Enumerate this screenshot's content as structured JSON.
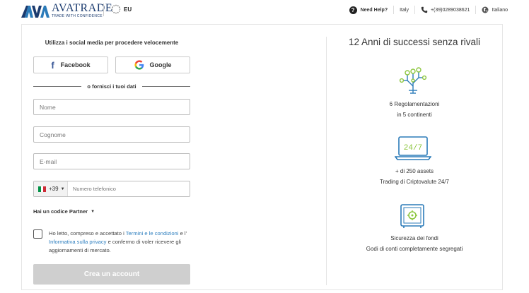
{
  "header": {
    "logo_name": "AVATRADE",
    "logo_tagline": "TRADE WITH CONFIDENCE",
    "region": "EU",
    "help": "Need Help?",
    "country": "Italy",
    "phone": "+(39)0289038621",
    "language": "Italiano"
  },
  "form": {
    "social_title": "Utilizza i social media per procedere velocemente",
    "facebook_label": "Facebook",
    "google_label": "Google",
    "or_text": "o fornisci i tuoi dati",
    "fields": {
      "first_name_placeholder": "Nome",
      "last_name_placeholder": "Cognome",
      "email_placeholder": "E-mail",
      "phone_prefix": "+39",
      "phone_placeholder": "Numero telefonico"
    },
    "partner_label": "Hai un codice Partner",
    "consent": {
      "part1": "Ho letto, compreso e accettato i ",
      "terms_link": "Termini e le condizioni",
      "part2": " e l' ",
      "privacy_link": "Informativa sulla privacy",
      "part3": " e confermo di voler ricevere gli aggiornamenti di mercato."
    },
    "submit_label": "Crea un account"
  },
  "benefits": {
    "title": "12 Anni di successi senza rivali",
    "items": [
      {
        "icon": "regulation-icon",
        "line1": "6 Regolamentazioni",
        "line2": "in 5 continenti"
      },
      {
        "icon": "laptop-24-7-icon",
        "line1": "+ di 250 assets",
        "line2": "Trading di Criptovalute 24/7"
      },
      {
        "icon": "safe-icon",
        "line1": "Sicurezza dei fondi",
        "line2": "Godi di conti completamente segregati"
      }
    ],
    "laptop_screen_text": "24/7"
  },
  "colors": {
    "brand_navy": "#1b3b6f",
    "icon_blue": "#2b7bb9",
    "icon_green": "#8cc63f",
    "link_blue": "#2e7fbf",
    "submit_disabled": "#cfcfcf"
  }
}
